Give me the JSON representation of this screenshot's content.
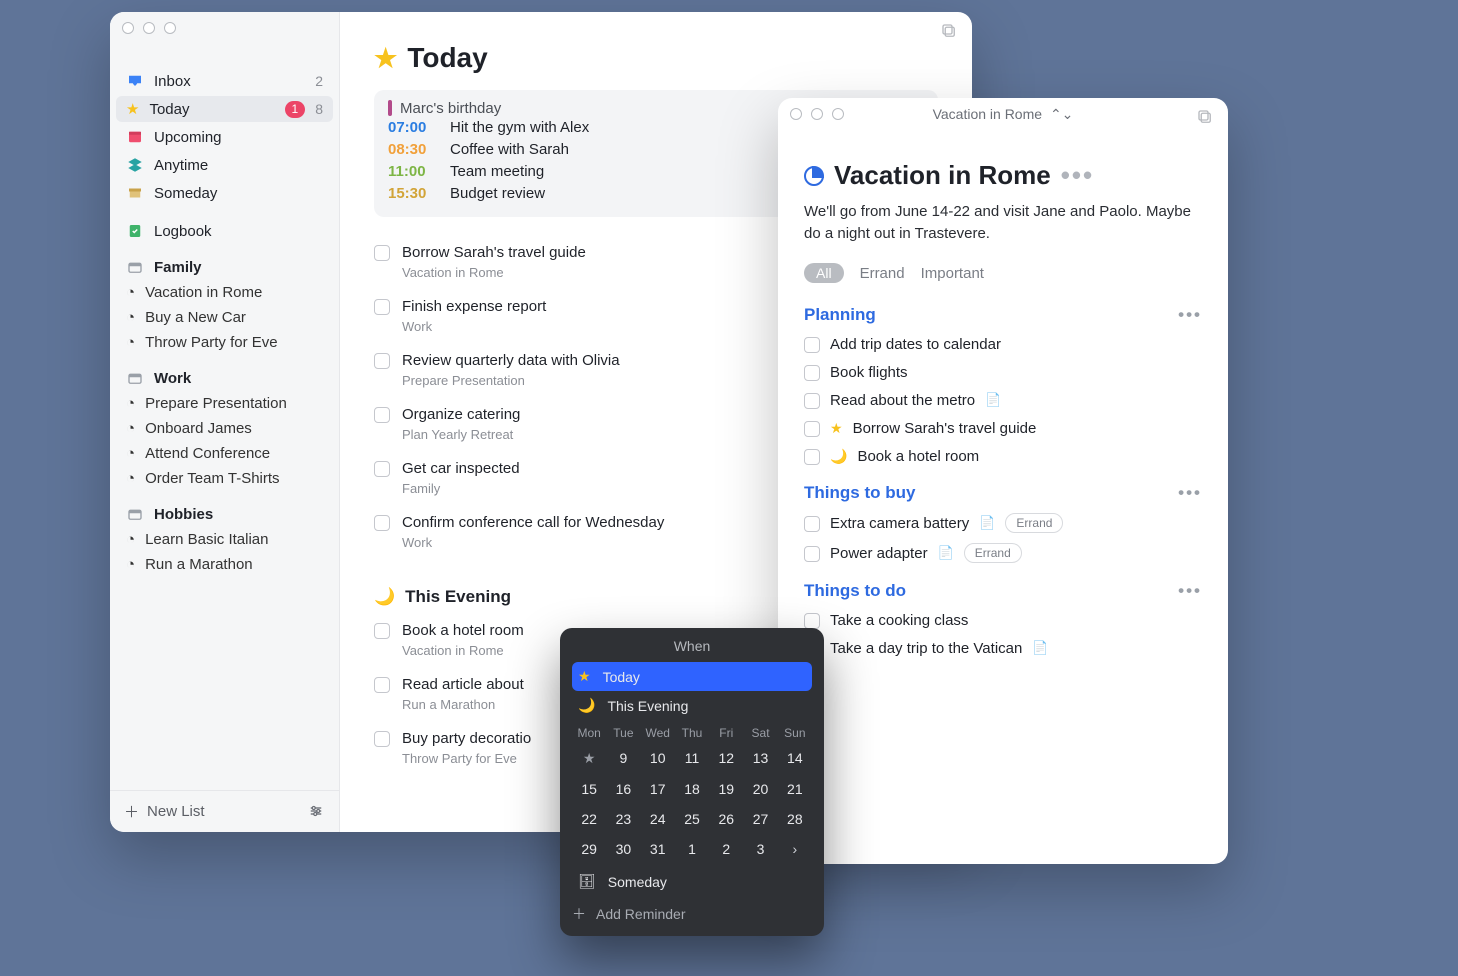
{
  "main": {
    "sidebar": {
      "nav": [
        {
          "icon": "inbox",
          "label": "Inbox",
          "count": "2"
        },
        {
          "icon": "star",
          "label": "Today",
          "selected": true,
          "badge": "1",
          "count": "8"
        },
        {
          "icon": "calendar",
          "label": "Upcoming"
        },
        {
          "icon": "stack",
          "label": "Anytime"
        },
        {
          "icon": "archive",
          "label": "Someday"
        }
      ],
      "logbook": {
        "label": "Logbook"
      },
      "areas": [
        {
          "name": "Family",
          "projects": [
            {
              "label": "Vacation in Rome"
            },
            {
              "label": "Buy a New Car"
            },
            {
              "label": "Throw Party for Eve"
            }
          ]
        },
        {
          "name": "Work",
          "projects": [
            {
              "label": "Prepare Presentation"
            },
            {
              "label": "Onboard James"
            },
            {
              "label": "Attend Conference"
            },
            {
              "label": "Order Team T-Shirts"
            }
          ]
        },
        {
          "name": "Hobbies",
          "projects": [
            {
              "label": "Learn Basic Italian"
            },
            {
              "label": "Run a Marathon"
            }
          ]
        }
      ],
      "footer": {
        "new_list": "New List"
      }
    },
    "page": {
      "title": "Today",
      "schedule": {
        "allday": "Marc's birthday",
        "events": [
          {
            "time": "07:00",
            "title": "Hit the gym with Alex",
            "color": "t-blue"
          },
          {
            "time": "08:30",
            "title": "Coffee with Sarah",
            "color": "t-orange"
          },
          {
            "time": "11:00",
            "title": "Team meeting",
            "color": "t-green"
          },
          {
            "time": "15:30",
            "title": "Budget review",
            "color": "t-gold"
          }
        ]
      },
      "tasks": [
        {
          "title": "Borrow Sarah's travel guide",
          "sub": "Vacation in Rome"
        },
        {
          "title": "Finish expense report",
          "sub": "Work"
        },
        {
          "title": "Review quarterly data with Olivia",
          "sub": "Prepare Presentation"
        },
        {
          "title": "Organize catering",
          "sub": "Plan Yearly Retreat"
        },
        {
          "title": "Get car inspected",
          "sub": "Family"
        },
        {
          "title": "Confirm conference call for Wednesday",
          "sub": "Work"
        }
      ],
      "evening": {
        "label": "This Evening",
        "tasks": [
          {
            "title": "Book a hotel room",
            "sub": "Vacation in Rome"
          },
          {
            "title": "Read article about",
            "sub": "Run a Marathon"
          },
          {
            "title": "Buy party decoratio",
            "sub": "Throw Party for Eve"
          }
        ]
      }
    }
  },
  "win2": {
    "titlebar": "Vacation in Rome",
    "title": "Vacation in Rome",
    "notes": "We'll go from June 14-22 and visit Jane and Paolo. Maybe do a night out in Trastevere.",
    "filters": {
      "all": "All",
      "f1": "Errand",
      "f2": "Important"
    },
    "sections": [
      {
        "name": "Planning",
        "tasks": [
          {
            "title": "Add trip dates to calendar"
          },
          {
            "title": "Book flights"
          },
          {
            "title": "Read about the metro",
            "note": true
          },
          {
            "title": "Borrow Sarah's travel guide",
            "star": true
          },
          {
            "title": "Book a hotel room",
            "moon": true
          }
        ]
      },
      {
        "name": "Things to buy",
        "tasks": [
          {
            "title": "Extra camera battery",
            "note": true,
            "tag": "Errand"
          },
          {
            "title": "Power adapter",
            "note": true,
            "tag": "Errand"
          }
        ]
      },
      {
        "name": "Things to do",
        "tasks": [
          {
            "title": "Take a cooking class"
          },
          {
            "title": "Take a day trip to the Vatican",
            "note": true
          }
        ]
      }
    ]
  },
  "when": {
    "header": "When",
    "today": "Today",
    "evening": "This Evening",
    "dow": [
      "Mon",
      "Tue",
      "Wed",
      "Thu",
      "Fri",
      "Sat",
      "Sun"
    ],
    "rows": [
      [
        "★",
        "9",
        "10",
        "11",
        "12",
        "13",
        "14"
      ],
      [
        "15",
        "16",
        "17",
        "18",
        "19",
        "20",
        "21"
      ],
      [
        "22",
        "23",
        "24",
        "25",
        "26",
        "27",
        "28"
      ],
      [
        "29",
        "30",
        "31",
        "1",
        "2",
        "3",
        "›"
      ]
    ],
    "someday": "Someday",
    "addReminder": "Add Reminder"
  },
  "icons": {
    "more": "•••",
    "chevron_updown": "⌄",
    "plus": "＋",
    "settings": "⚙",
    "note": "📄",
    "moon": "🌙",
    "star": "★",
    "archive": "🗄",
    "chev_right": "›"
  },
  "colors": {
    "accent": "#2e6ae0",
    "star": "#f7c21e",
    "badge": "#ec4467"
  }
}
